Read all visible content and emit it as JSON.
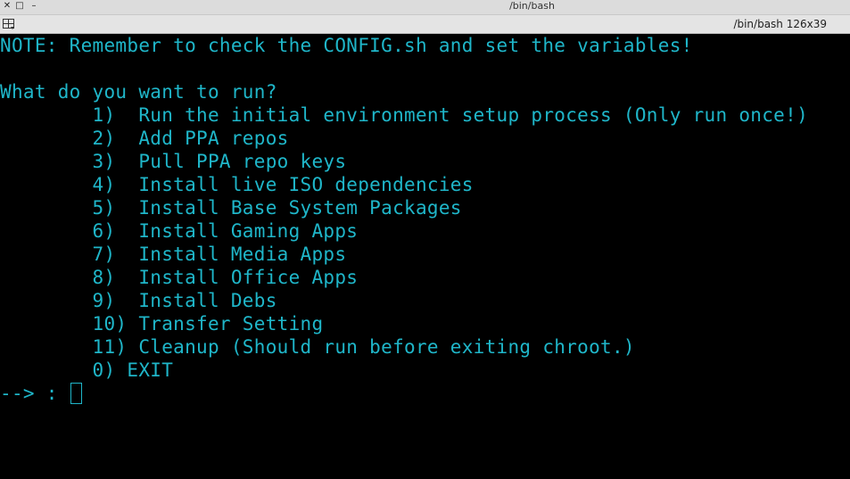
{
  "window": {
    "title": "/bin/bash",
    "close_glyph": "✕",
    "maximize_glyph": "□",
    "minimize_glyph": "–"
  },
  "tab": {
    "label": "/bin/bash 126x39"
  },
  "terminal": {
    "note": "NOTE: Remember to check the CONFIG.sh and set the variables!",
    "question": "What do you want to run?",
    "menu": [
      "        1)  Run the initial environment setup process (Only run once!)",
      "        2)  Add PPA repos",
      "        3)  Pull PPA repo keys",
      "        4)  Install live ISO dependencies",
      "        5)  Install Base System Packages",
      "        6)  Install Gaming Apps",
      "        7)  Install Media Apps",
      "        8)  Install Office Apps",
      "        9)  Install Debs",
      "        10) Transfer Setting",
      "        11) Cleanup (Should run before exiting chroot.)",
      "        0) EXIT"
    ],
    "prompt": "--> : "
  },
  "colors": {
    "text": "#1fb6c9",
    "background": "#000000"
  }
}
